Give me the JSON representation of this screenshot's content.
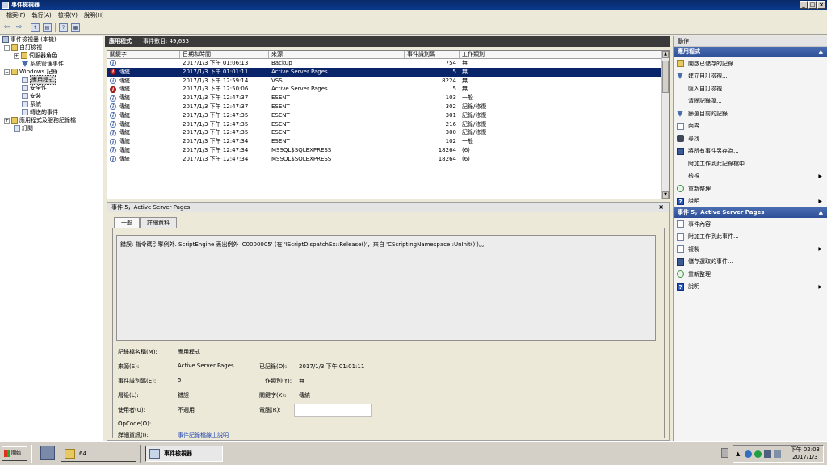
{
  "window": {
    "title": "事件檢視器",
    "buttons": [
      "_",
      "□",
      "×"
    ]
  },
  "menu": [
    "檔案(F)",
    "執行(A)",
    "檢視(V)",
    "說明(H)"
  ],
  "toolbar": {
    "icons": [
      "back-arrow-icon",
      "forward-arrow-icon",
      "up-folder-icon",
      "show-hide-tree-icon",
      "help-icon",
      "properties-icon"
    ]
  },
  "tree": {
    "root": "事件檢視器 (本機)",
    "custom_views": "自訂檢視",
    "server_roles": "伺服器角色",
    "admin_events": "系統管理事件",
    "windows_logs": "Windows 記錄",
    "application": "應用程式",
    "security": "安全性",
    "setup": "安裝",
    "system": "系統",
    "forwarded": "轉送的事件",
    "app_service_logs": "應用程式及服務記錄檔",
    "subscriptions": "訂閱"
  },
  "center": {
    "log_name": "應用程式",
    "event_count_label": "事件數目: 49,633"
  },
  "table": {
    "columns": [
      "關鍵字",
      "日期和時間",
      "來源",
      "事件識別碼",
      "工作類別"
    ],
    "rows": [
      {
        "icon": "info",
        "keyword": "",
        "date": "2017/1/3 下午 01:06:13",
        "source": "Backup",
        "id": "754",
        "category": "無"
      },
      {
        "icon": "err",
        "keyword": "傳統",
        "date": "2017/1/3 下午 01:01:11",
        "source": "Active Server Pages",
        "id": "5",
        "category": "無",
        "selected": true
      },
      {
        "icon": "info",
        "keyword": "傳統",
        "date": "2017/1/3 下午 12:59:14",
        "source": "VSS",
        "id": "8224",
        "category": "無"
      },
      {
        "icon": "err",
        "keyword": "傳統",
        "date": "2017/1/3 下午 12:50:06",
        "source": "Active Server Pages",
        "id": "5",
        "category": "無"
      },
      {
        "icon": "info",
        "keyword": "傳統",
        "date": "2017/1/3 下午 12:47:37",
        "source": "ESENT",
        "id": "103",
        "category": "一般"
      },
      {
        "icon": "info",
        "keyword": "傳統",
        "date": "2017/1/3 下午 12:47:37",
        "source": "ESENT",
        "id": "302",
        "category": "記錄/修復"
      },
      {
        "icon": "info",
        "keyword": "傳統",
        "date": "2017/1/3 下午 12:47:35",
        "source": "ESENT",
        "id": "301",
        "category": "記錄/修復"
      },
      {
        "icon": "info",
        "keyword": "傳統",
        "date": "2017/1/3 下午 12:47:35",
        "source": "ESENT",
        "id": "216",
        "category": "記錄/修復"
      },
      {
        "icon": "info",
        "keyword": "傳統",
        "date": "2017/1/3 下午 12:47:35",
        "source": "ESENT",
        "id": "300",
        "category": "記錄/修復"
      },
      {
        "icon": "info",
        "keyword": "傳統",
        "date": "2017/1/3 下午 12:47:34",
        "source": "ESENT",
        "id": "102",
        "category": "一般"
      },
      {
        "icon": "info",
        "keyword": "傳統",
        "date": "2017/1/3 下午 12:47:34",
        "source": "MSSQL$SQLEXPRESS",
        "id": "18264",
        "category": "(6)"
      },
      {
        "icon": "info",
        "keyword": "傳統",
        "date": "2017/1/3 下午 12:47:34",
        "source": "MSSQL$SQLEXPRESS",
        "id": "18264",
        "category": "(6)"
      }
    ]
  },
  "detail": {
    "header": "事件 5，Active Server Pages",
    "tabs": [
      "一般",
      "詳細資料"
    ],
    "description": "錯誤: 指令碼引擎例外. ScriptEngine 丟出例外 'C0000005' (在 'IScriptDispatchEx::Release()'，來自 'CScriptingNamespace::UnInit()')。。",
    "props": {
      "log_name_label": "記錄檔名稱(M):",
      "log_name_value": "應用程式",
      "source_label": "來源(S):",
      "source_value": "Active Server Pages",
      "logged_label": "已記錄(D):",
      "logged_value": "2017/1/3 下午 01:01:11",
      "event_id_label": "事件識別碼(E):",
      "event_id_value": "5",
      "task_label": "工作類別(Y):",
      "task_value": "無",
      "level_label": "層級(L):",
      "level_value": "錯誤",
      "keyword_label": "關鍵字(K):",
      "keyword_value": "傳統",
      "user_label": "使用者(U):",
      "user_value": "不適用",
      "computer_label": "電腦(R):",
      "computer_value": "",
      "opcode_label": "OpCode(O):",
      "more_info_label": "詳細資訊(I):",
      "more_info_link": "事件記錄檔線上說明"
    }
  },
  "actions": {
    "header": "動作",
    "section1": "應用程式",
    "items1": [
      {
        "icon": "folder",
        "label": "開啟已儲存的記錄..."
      },
      {
        "icon": "filt",
        "label": "建立自訂檢視..."
      },
      {
        "icon": "blank",
        "label": "匯入自訂檢視..."
      },
      {
        "icon": "blank",
        "label": "清除記錄檔..."
      },
      {
        "icon": "filt",
        "label": "篩選目前的記錄..."
      },
      {
        "icon": "doc",
        "label": "內容"
      },
      {
        "icon": "bino",
        "label": "尋找..."
      },
      {
        "icon": "save",
        "label": "將所有事件另存為..."
      },
      {
        "icon": "blank",
        "label": "附加工作到此記錄檔中..."
      },
      {
        "icon": "blank",
        "label": "檢視",
        "arrow": true
      },
      {
        "icon": "refresh",
        "label": "重新整理"
      },
      {
        "icon": "help",
        "label": "說明",
        "arrow": true
      }
    ],
    "section2": "事件 5，Active Server Pages",
    "items2": [
      {
        "icon": "doc",
        "label": "事件內容"
      },
      {
        "icon": "doc",
        "label": "附加工作到此事件..."
      },
      {
        "icon": "doc",
        "label": "複製",
        "arrow": true
      },
      {
        "icon": "save",
        "label": "儲存選取的事件..."
      },
      {
        "icon": "refresh",
        "label": "重新整理"
      },
      {
        "icon": "help",
        "label": "說明",
        "arrow": true
      }
    ]
  },
  "taskbar": {
    "start": "開始",
    "folder_count": "64",
    "active_task": "事件檢視器",
    "clock_time": "下午 02:03",
    "clock_date": "2017/1/3"
  }
}
